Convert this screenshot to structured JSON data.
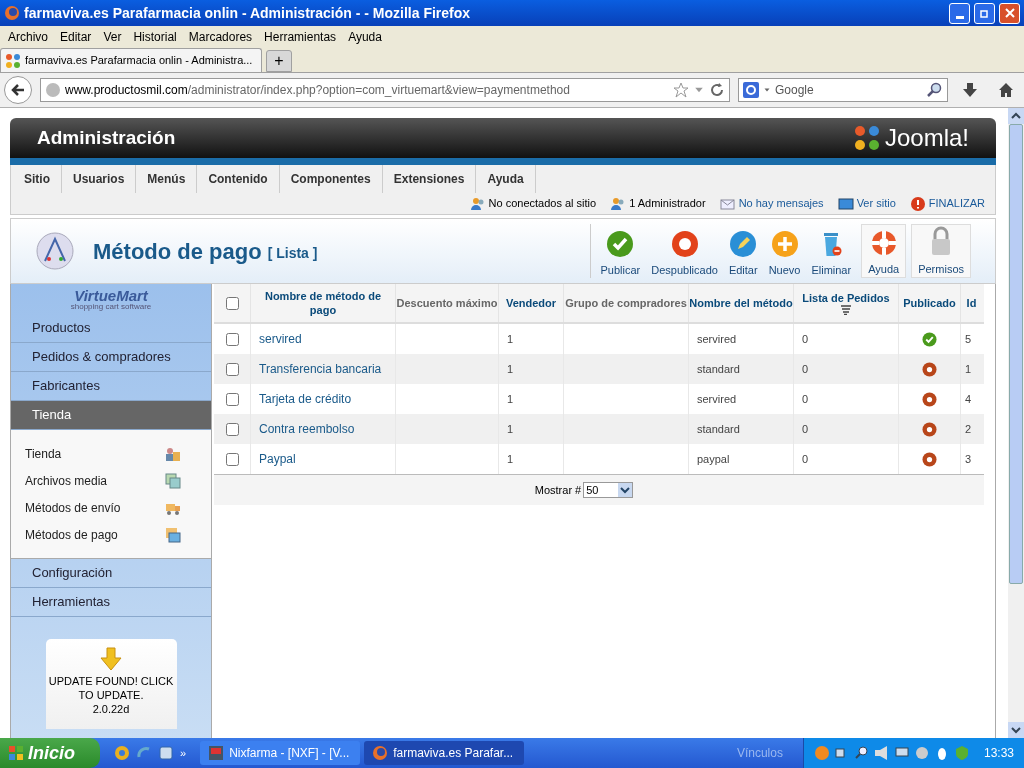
{
  "window": {
    "title": "farmaviva.es Parafarmacia onlin - Administración - - Mozilla Firefox"
  },
  "browser_menu": [
    "Archivo",
    "Editar",
    "Ver",
    "Historial",
    "Marcadores",
    "Herramientas",
    "Ayuda"
  ],
  "tabs": [
    {
      "label": "farmaviva.es Parafarmacia onlin - Administra...",
      "selected": true
    }
  ],
  "new_tab": "+",
  "address": {
    "host": "www.productosmil.com",
    "path": "/administrator/index.php?option=com_virtuemart&view=paymentmethod"
  },
  "search": {
    "placeholder": "Google"
  },
  "admin": {
    "title": "Administración",
    "logo": "Joomla!"
  },
  "main_menu": [
    "Sitio",
    "Usuarios",
    "Menús",
    "Contenido",
    "Componentes",
    "Extensiones",
    "Ayuda"
  ],
  "status": [
    {
      "kind": "users",
      "label": "No conectados al sitio"
    },
    {
      "kind": "admin",
      "label": "1 Administrador"
    },
    {
      "kind": "messages",
      "label": "No hay mensajes"
    },
    {
      "kind": "site",
      "label": "Ver sitio"
    },
    {
      "kind": "logout",
      "label": "FINALIZAR"
    }
  ],
  "page": {
    "title": "Método de pago",
    "subtitle": "[ Lista ]"
  },
  "toolbar": [
    {
      "kind": "publish",
      "label": "Publicar"
    },
    {
      "kind": "unpublish",
      "label": "Despublicado"
    },
    {
      "kind": "edit",
      "label": "Editar"
    },
    {
      "kind": "new",
      "label": "Nuevo"
    },
    {
      "kind": "delete",
      "label": "Eliminar"
    },
    {
      "kind": "help",
      "label": "Ayuda"
    },
    {
      "kind": "permissions",
      "label": "Permisos"
    }
  ],
  "sidebar": {
    "logo": "VirtueMart",
    "logo_tagline": "shopping cart software",
    "sections": [
      {
        "label": "Productos",
        "expanded": false
      },
      {
        "label": "Pedidos & compradores",
        "expanded": false
      },
      {
        "label": "Fabricantes",
        "expanded": false
      },
      {
        "label": "Tienda",
        "expanded": true,
        "children": [
          {
            "label": "Tienda",
            "kind": "store"
          },
          {
            "label": "Archivos media",
            "kind": "media"
          },
          {
            "label": "Métodos de envío",
            "kind": "shipping"
          },
          {
            "label": "Métodos de pago",
            "kind": "payment"
          }
        ]
      },
      {
        "label": "Configuración",
        "expanded": false
      },
      {
        "label": "Herramientas",
        "expanded": false
      }
    ],
    "update": {
      "text": "UPDATE FOUND! CLICK TO UPDATE.",
      "version": "2.0.22d"
    }
  },
  "table": {
    "select_all": {
      "checked": false
    },
    "columns": [
      {
        "label": "Nombre de método de pago",
        "sortable": true,
        "sorted": false
      },
      {
        "label": "Descuento máximo",
        "sortable": false,
        "sorted": false
      },
      {
        "label": "Vendedor",
        "sortable": true,
        "sorted": false
      },
      {
        "label": "Grupo de compradores",
        "sortable": false,
        "sorted": false
      },
      {
        "label": "Nombre del método",
        "sortable": true,
        "sorted": false
      },
      {
        "label": "Lista de Pedidos",
        "sortable": true,
        "sorted": true
      },
      {
        "label": "Publicado",
        "sortable": true,
        "sorted": false
      },
      {
        "label": "Id",
        "sortable": true,
        "sorted": false
      }
    ],
    "rows": [
      {
        "checked": false,
        "name": "servired",
        "vendor": "1",
        "method": "servired",
        "orders": "0",
        "published": true,
        "id": "5"
      },
      {
        "checked": false,
        "name": "Transferencia bancaria",
        "vendor": "1",
        "method": "standard",
        "orders": "0",
        "published": false,
        "id": "1"
      },
      {
        "checked": false,
        "name": "Tarjeta de crédito",
        "vendor": "1",
        "method": "servired",
        "orders": "0",
        "published": false,
        "id": "4"
      },
      {
        "checked": false,
        "name": "Contra reembolso",
        "vendor": "1",
        "method": "standard",
        "orders": "0",
        "published": false,
        "id": "2"
      },
      {
        "checked": false,
        "name": "Paypal",
        "vendor": "1",
        "method": "paypal",
        "orders": "0",
        "published": false,
        "id": "3"
      }
    ],
    "pagination": {
      "label": "Mostrar #",
      "value": "50"
    }
  },
  "taskbar": {
    "start": "Inicio",
    "more": "»",
    "tasks": [
      {
        "label": "Nixfarma - [NXF] - [V...",
        "selected": false
      },
      {
        "label": "farmaviva.es Parafar...",
        "selected": true
      }
    ],
    "links": "Vínculos",
    "clock": "13:33"
  }
}
